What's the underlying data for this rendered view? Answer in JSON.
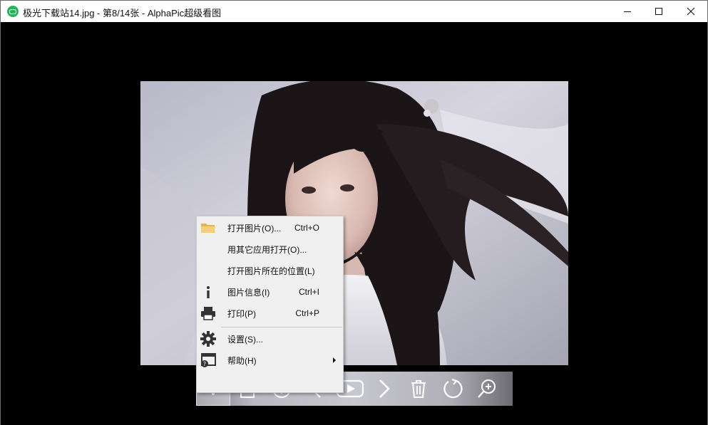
{
  "window": {
    "title": "极光下载站14.jpg - 第8/14张 - AlphaPic超级看图",
    "controls": [
      "minimize-icon",
      "maximize-icon",
      "close-icon"
    ]
  },
  "context_menu": {
    "items": [
      {
        "label": "打开图片(O)...",
        "shortcut": "Ctrl+O",
        "icon": "folder-icon"
      },
      {
        "label": "用其它应用打开(O)...",
        "shortcut": "",
        "icon": ""
      },
      {
        "label": "打开图片所在的位置(L)",
        "shortcut": "",
        "icon": ""
      },
      {
        "label": "图片信息(I)",
        "shortcut": "Ctrl+I",
        "icon": "info-letter-icon"
      },
      {
        "label": "打印(P)",
        "shortcut": "Ctrl+P",
        "icon": "printer-icon"
      },
      {
        "label": "设置(S)...",
        "shortcut": "",
        "icon": "gear-icon"
      },
      {
        "label": "帮助(H)",
        "shortcut": "",
        "icon": "help-window-icon",
        "submenu": true
      }
    ]
  },
  "toolbar": {
    "buttons": [
      "more-menu-icon",
      "page-icon",
      "info-icon",
      "previous-icon",
      "slideshow-icon",
      "next-icon",
      "trash-icon",
      "rotate-icon",
      "zoom-in-icon"
    ]
  },
  "colors": {
    "titlebar_bg": "#ffffff",
    "viewer_bg": "#000000",
    "menu_bg": "#f0f0f0",
    "app_icon": "#27b35a"
  }
}
